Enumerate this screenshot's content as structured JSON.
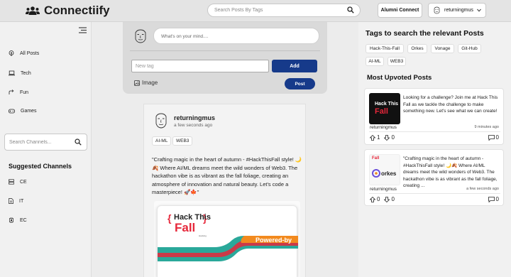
{
  "header": {
    "brand": "Connectiify",
    "search_placeholder": "Search Posts By Tags",
    "alumni_label": "Alumni Connect",
    "username": "returningmus"
  },
  "sidebar": {
    "nav": [
      {
        "label": "All Posts",
        "icon": "podcast-icon"
      },
      {
        "label": "Tech",
        "icon": "laptop-icon"
      },
      {
        "label": "Fun",
        "icon": "share-icon"
      },
      {
        "label": "Games",
        "icon": "gamepad-icon"
      }
    ],
    "channel_search_placeholder": "Search Channels...",
    "suggested_title": "Suggested Channels",
    "channels": [
      "CE",
      "IT",
      "EC"
    ]
  },
  "composer": {
    "placeholder": "What's on your mind....",
    "new_tag_placeholder": "New tag",
    "add_label": "Add",
    "image_label": "Image",
    "post_label": "Post"
  },
  "post": {
    "user": "returningmus",
    "time": "a few seconds ago",
    "tags": [
      "AI-ML",
      "WEB3"
    ],
    "text": "\"Crafting magic in the heart of autumn - #HackThisFall style! 🌙🍂 Where AI/ML dreams meet the wild wonders of Web3. The hackathon vibe is as vibrant as the fall foliage, creating an atmosphere of innovation and natural beauty. Let's code a masterpiece! 🚀🍁\"",
    "image_top": "Hack This",
    "image_bottom": "Fall",
    "image_small": "Hacking",
    "image_banner": "Powered-by"
  },
  "right": {
    "tags_title": "Tags to search the relevant Posts",
    "tags": [
      "Hack-This-Fall",
      "Orkes",
      "Vonage",
      "Git-Hub",
      "AI-ML",
      "WEB3"
    ],
    "upvoted_title": "Most Upvoted Posts",
    "upvoted": [
      {
        "text": "Looking for a challenge? Join me at Hack This Fall as we tackle the challenge to make something new. Let's see what we can create!",
        "user": "returningmus",
        "time": "9 minutes ago",
        "up": "1",
        "down": "0",
        "comments": "0",
        "thumb_line1": "Hack This",
        "thumb_line2": "Fall"
      },
      {
        "text": "\"Crafting magic in the heart of autumn - #HackThisFall style! 🌙🍂 Where AI/ML dreams meet the wild wonders of Web3. The hackathon vibe is as vibrant as the fall foliage, creating ...",
        "user": "returningmus",
        "time": "a few seconds ago",
        "up": "0",
        "down": "0",
        "comments": "0",
        "thumb_logo": "orkes",
        "thumb_badge": "Fall"
      }
    ]
  },
  "colors": {
    "primary": "#163a8a",
    "accent_orange": "#f28a1e",
    "accent_red": "#e6273a"
  }
}
